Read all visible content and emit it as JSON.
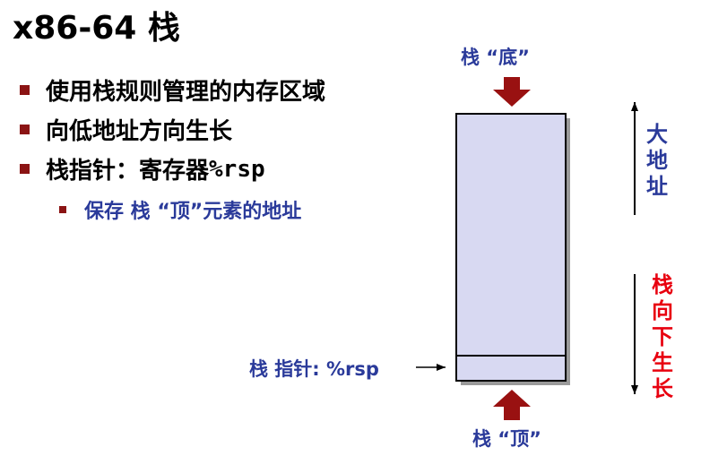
{
  "title": "x86-64 栈",
  "bullets": [
    "使用栈规则管理的内存区域",
    "向低地址方向生长",
    "栈指针：寄存器 "
  ],
  "register_name": "%rsp",
  "sub_bullet": "保存 栈 “顶”元素的地址",
  "stack_bottom_label": "栈 “底”",
  "stack_top_label": "栈 “顶”",
  "stack_pointer_label": "栈 指针: %rsp",
  "high_address_label": "大地址",
  "grows_down_label": "栈向下生长",
  "colors": {
    "bullet_marker": "#8b1414",
    "blue_text": "#2a3a9a",
    "red_text": "#e8000f",
    "stack_fill": "#d8d9f2",
    "arrow": "#991111"
  }
}
